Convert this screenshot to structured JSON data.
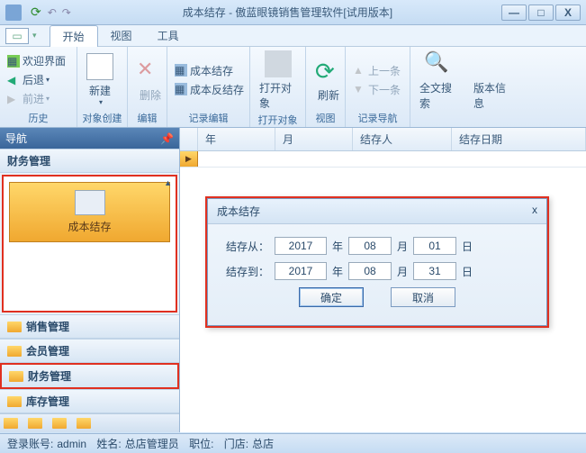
{
  "window": {
    "title": "成本结存 - 傲蓝眼镜销售管理软件[试用版本]"
  },
  "win_btns": {
    "min": "—",
    "max": "□",
    "close": "X"
  },
  "tabs": {
    "start": "开始",
    "view": "视图",
    "tools": "工具"
  },
  "ribbon": {
    "welcome": "欢迎界面",
    "back": "后退",
    "forward": "前进",
    "g_history": "历史",
    "new": "新建",
    "g_create": "对象创建",
    "delete": "删除",
    "g_edit": "编辑",
    "cost_close": "成本结存",
    "cost_rev": "成本反结存",
    "g_record": "记录编辑",
    "open_obj": "打开对象",
    "g_open": "打开对象",
    "refresh": "刷新",
    "g_view": "视图",
    "prev": "上一条",
    "next": "下一条",
    "g_nav": "记录导航",
    "search": "全文搜索",
    "version": "版本信息"
  },
  "nav": {
    "title": "导航",
    "finance": "财务管理",
    "item_cost": "成本结存",
    "sales": "销售管理",
    "member": "会员管理",
    "finance2": "财务管理",
    "stock": "库存管理"
  },
  "grid": {
    "year": "年",
    "month": "月",
    "person": "结存人",
    "date": "结存日期"
  },
  "dialog": {
    "title": "成本结存",
    "from_lbl": "结存从：",
    "to_lbl": "结存到：",
    "yr": "年",
    "mo": "月",
    "dy": "日",
    "from_y": "2017",
    "from_m": "08",
    "from_d": "01",
    "to_y": "2017",
    "to_m": "08",
    "to_d": "31",
    "ok": "确定",
    "cancel": "取消",
    "close": "x"
  },
  "status": {
    "acct_lbl": "登录账号:",
    "acct": "admin",
    "name_lbl": "姓名:",
    "name": "总店管理员",
    "pos_lbl": "职位:",
    "store_lbl": "门店:",
    "store": "总店"
  }
}
